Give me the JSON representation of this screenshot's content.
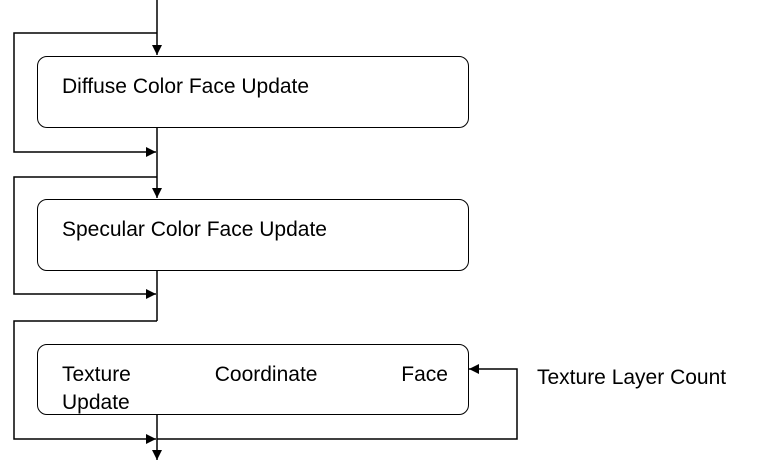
{
  "diagram": {
    "steps": [
      {
        "label": "Diffuse Color Face Update"
      },
      {
        "label": "Specular Color Face Update"
      },
      {
        "label_line1_words": [
          "Texture",
          "Coordinate",
          "Face"
        ],
        "label_line2": "Update"
      }
    ],
    "loop_label": "Texture Layer Count",
    "line_color": "#000000"
  }
}
